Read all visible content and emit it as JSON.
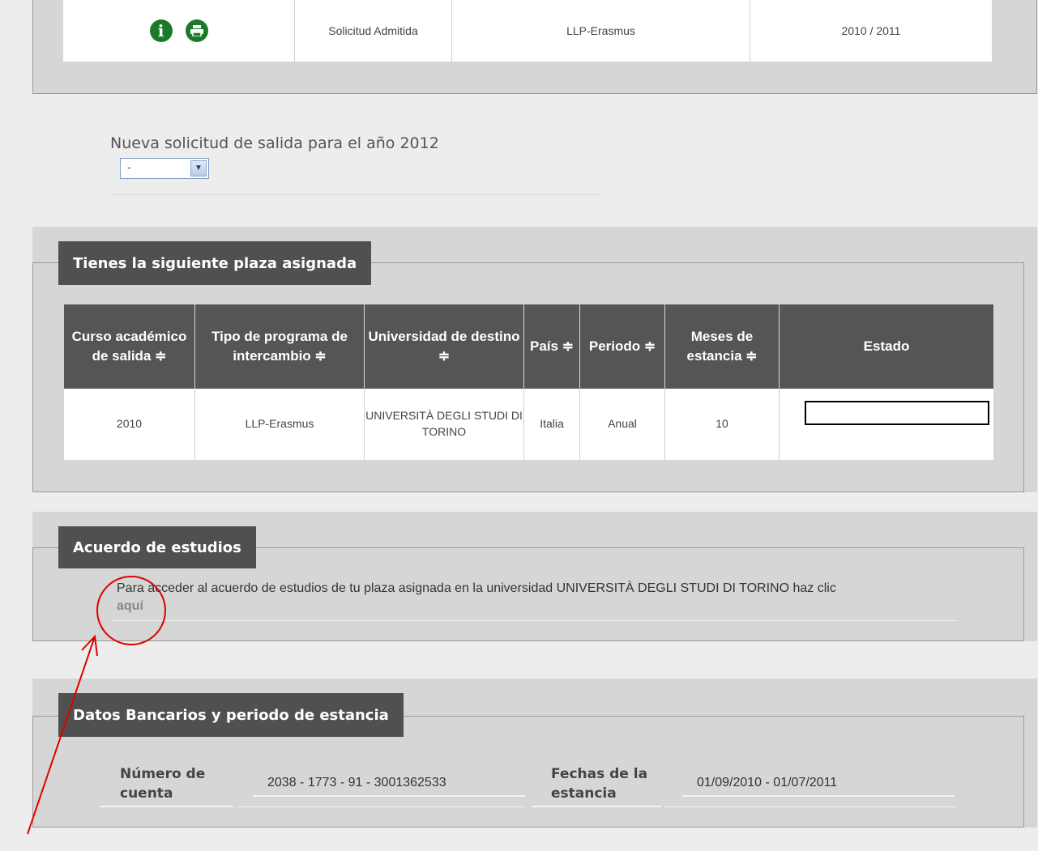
{
  "top_table": {
    "row": {
      "status": "Solicitud Admitida",
      "program": "LLP-Erasmus",
      "year": "2010 / 2011"
    },
    "icons": [
      "info-icon",
      "print-icon"
    ]
  },
  "new_request": {
    "label": "Nueva solicitud de salida para el año 2012",
    "select_value": "-"
  },
  "assigned": {
    "legend": "Tienes la siguiente plaza asignada",
    "headers": [
      "Curso académico de salida ≑",
      "Tipo de programa de intercambio ≑",
      "Universidad de destino ≑",
      "País ≑",
      "Periodo ≑",
      "Meses de estancia ≑",
      "Estado"
    ],
    "row": {
      "course": "2010",
      "program": "LLP-Erasmus",
      "university": "UNIVERSITÀ DEGLI STUDI DI TORINO",
      "country": "Italia",
      "period": "Anual",
      "months": "10",
      "estado": ""
    }
  },
  "agreement": {
    "legend": "Acuerdo de estudios",
    "text": "Para acceder al acuerdo de estudios de tu plaza asignada en la universidad UNIVERSITÀ DEGLI STUDI DI TORINO  haz clic",
    "link": "aquí"
  },
  "bank": {
    "legend": "Datos Bancarios y periodo de estancia",
    "account_label": "Número de cuenta",
    "account_value": "2038 - 1773 - 91 - 3001362533",
    "dates_label": "Fechas de la estancia",
    "dates_value": "01/09/2010 - 01/07/2011"
  },
  "annotation": {
    "color": "#e00000",
    "shape": "circle-with-arrow"
  }
}
